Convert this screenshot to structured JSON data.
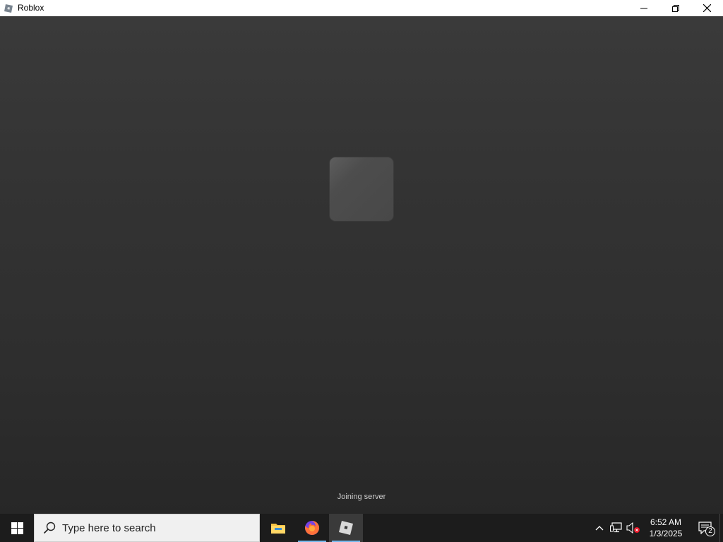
{
  "window": {
    "title": "Roblox",
    "icon": "roblox-icon",
    "controls": [
      "minimize-icon",
      "restore-icon",
      "close-icon"
    ]
  },
  "game": {
    "status_text": "Joining server"
  },
  "taskbar": {
    "search_placeholder": "Type here to search",
    "apps": [
      {
        "name": "File Explorer",
        "icon": "folder-icon",
        "active": false
      },
      {
        "name": "Firefox",
        "icon": "firefox-icon",
        "active": false,
        "running": true
      },
      {
        "name": "Roblox",
        "icon": "roblox-icon",
        "active": true,
        "running": true
      }
    ],
    "tray": {
      "time": "6:52 AM",
      "date": "1/3/2025",
      "notification_count": "2"
    }
  },
  "colors": {
    "taskbar_bg": "#1c1c1c",
    "indicator": "#76b9ed",
    "viewport_bg": "#333333"
  }
}
